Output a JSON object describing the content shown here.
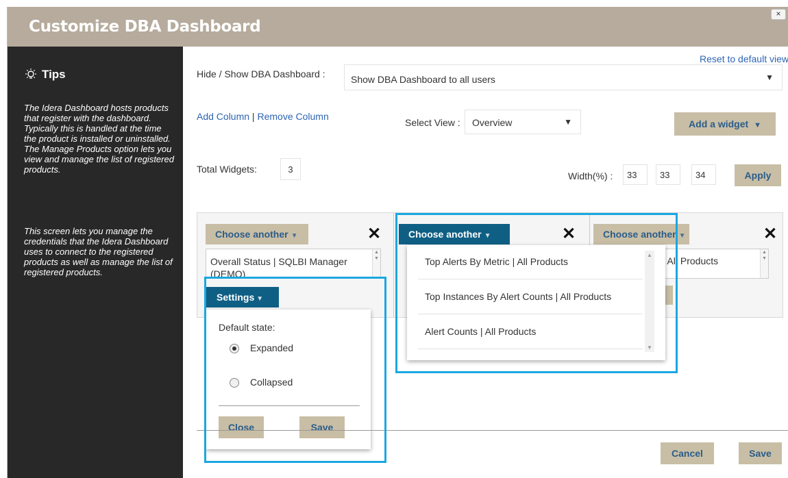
{
  "dialog": {
    "title": "Customize DBA Dashboard",
    "close_label": "×"
  },
  "tips": {
    "heading": "Tips",
    "paragraph1": "The Idera Dashboard hosts products that register with the dashboard. Typically this is handled at the time the product is installed or uninstalled. The Manage Products option lets you view and manage the list of registered products.",
    "paragraph2": "This screen lets you manage the credentials that the Idera Dashboard uses to connect to the registered products as well as manage the list of registered products."
  },
  "toolbar": {
    "reset_link": "Reset to default view",
    "hide_show_label": "Hide / Show DBA Dashboard :",
    "hide_show_value": "Show DBA Dashboard to all users",
    "add_column": "Add Column",
    "separator": " | ",
    "remove_column": "Remove Column",
    "select_view_label": "Select View :",
    "select_view_value": "Overview",
    "add_widget": "Add a widget",
    "total_widgets_label": "Total Widgets:",
    "total_widgets_value": "3",
    "width_label": "Width(%) :",
    "widths": [
      "33",
      "33",
      "34"
    ],
    "apply": "Apply"
  },
  "columns": [
    {
      "choose_label": "Choose another",
      "widget": "Overall Status | SQLBI Manager (DEMO)"
    },
    {
      "choose_label": "Choose another"
    },
    {
      "choose_label": "Choose another",
      "widget": "Alerts | All Products"
    }
  ],
  "dropdown": {
    "items": [
      "Top Alerts By Metric | All Products",
      "Top Instances By Alert Counts | All Products",
      "Alert Counts | All Products"
    ]
  },
  "settings": {
    "button": "Settings",
    "default_state_label": "Default state:",
    "options": [
      "Expanded",
      "Collapsed"
    ],
    "selected": "Expanded",
    "close": "Close",
    "save": "Save"
  },
  "footer": {
    "cancel": "Cancel",
    "save": "Save"
  },
  "colors": {
    "header": "#b6ab9c",
    "tan_button": "#c8bea5",
    "blue_button": "#0f5f85",
    "highlight": "#1aa7e2",
    "sidebar": "#282828",
    "link": "#2d64b3"
  },
  "icons": {
    "tips": "lightbulb-icon",
    "dropdown": "caret-down-icon",
    "remove": "close-icon"
  }
}
